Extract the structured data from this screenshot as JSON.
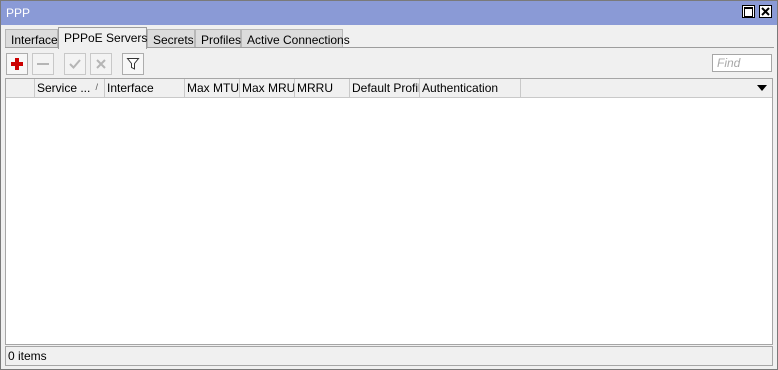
{
  "window": {
    "title": "PPP",
    "titlebar_color": "#8a9ad6"
  },
  "tabs": [
    {
      "label": "Interface",
      "active": false
    },
    {
      "label": "PPPoE Servers",
      "active": true
    },
    {
      "label": "Secrets",
      "active": false
    },
    {
      "label": "Profiles",
      "active": false
    },
    {
      "label": "Active Connections",
      "active": false
    }
  ],
  "toolbar": {
    "add_icon": "plus-icon",
    "remove_icon": "minus-icon",
    "enable_icon": "check-icon",
    "disable_icon": "x-icon",
    "filter_icon": "funnel-icon",
    "find_placeholder": "Find",
    "accent_add": "#cc0000"
  },
  "table": {
    "columns": [
      {
        "label": ""
      },
      {
        "label": "Service ...",
        "sorted": "asc"
      },
      {
        "label": "Interface"
      },
      {
        "label": "Max MTU"
      },
      {
        "label": "Max MRU"
      },
      {
        "label": "MRRU"
      },
      {
        "label": "Default Profile"
      },
      {
        "label": "Authentication"
      }
    ],
    "rows": []
  },
  "status": {
    "text": "0 items"
  }
}
